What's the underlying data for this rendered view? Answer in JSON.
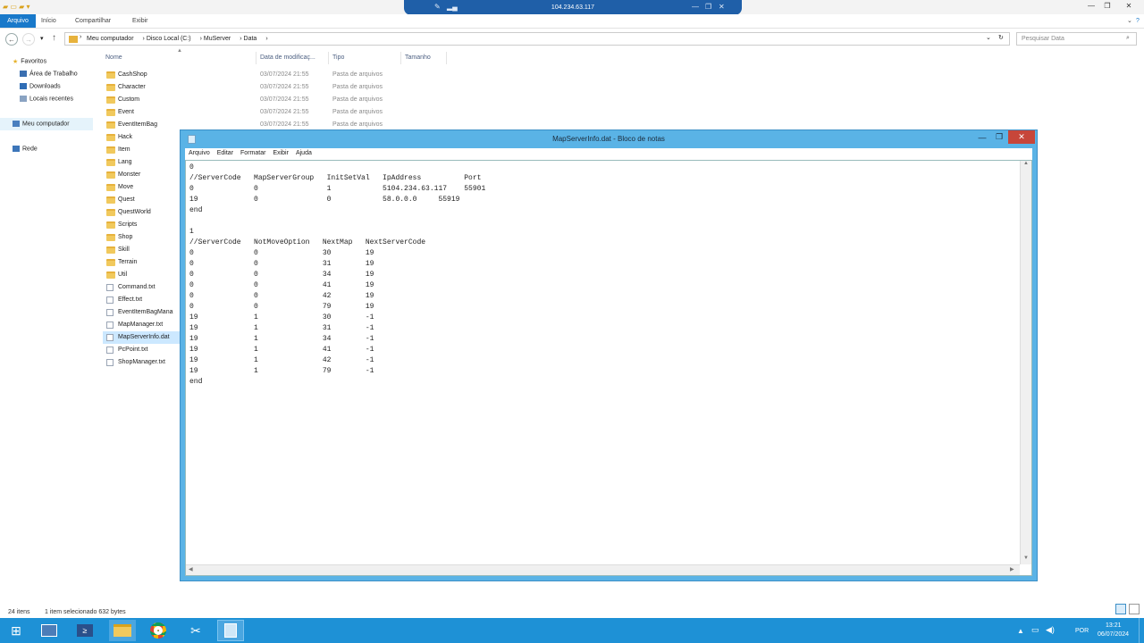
{
  "rdp": {
    "host": "104.234.63.117"
  },
  "ribbon": {
    "file": "Arquivo",
    "home": "Início",
    "share": "Compartilhar",
    "view": "Exibir"
  },
  "address": {
    "crumbs": [
      "Meu computador",
      "Disco Local (C:)",
      "MuServer",
      "Data"
    ],
    "search_placeholder": "Pesquisar Data"
  },
  "columns": {
    "name": "Nome",
    "date": "Data de modificaç...",
    "type": "Tipo",
    "size": "Tamanho"
  },
  "nav": {
    "favorites": "Favoritos",
    "desktop": "Área de Trabalho",
    "downloads": "Downloads",
    "recent": "Locais recentes",
    "computer": "Meu computador",
    "network": "Rede"
  },
  "files": [
    {
      "name": "CashShop",
      "date": "03/07/2024 21:55",
      "type": "Pasta de arquivos",
      "kind": "folder"
    },
    {
      "name": "Character",
      "date": "03/07/2024 21:55",
      "type": "Pasta de arquivos",
      "kind": "folder"
    },
    {
      "name": "Custom",
      "date": "03/07/2024 21:55",
      "type": "Pasta de arquivos",
      "kind": "folder"
    },
    {
      "name": "Event",
      "date": "03/07/2024 21:55",
      "type": "Pasta de arquivos",
      "kind": "folder"
    },
    {
      "name": "EventItemBag",
      "date": "03/07/2024 21:55",
      "type": "Pasta de arquivos",
      "kind": "folder"
    },
    {
      "name": "Hack",
      "date": "",
      "type": "",
      "kind": "folder"
    },
    {
      "name": "Item",
      "date": "",
      "type": "",
      "kind": "folder"
    },
    {
      "name": "Lang",
      "date": "",
      "type": "",
      "kind": "folder"
    },
    {
      "name": "Monster",
      "date": "",
      "type": "",
      "kind": "folder"
    },
    {
      "name": "Move",
      "date": "",
      "type": "",
      "kind": "folder"
    },
    {
      "name": "Quest",
      "date": "",
      "type": "",
      "kind": "folder"
    },
    {
      "name": "QuestWorld",
      "date": "",
      "type": "",
      "kind": "folder"
    },
    {
      "name": "Scripts",
      "date": "",
      "type": "",
      "kind": "folder"
    },
    {
      "name": "Shop",
      "date": "",
      "type": "",
      "kind": "folder"
    },
    {
      "name": "Skill",
      "date": "",
      "type": "",
      "kind": "folder"
    },
    {
      "name": "Terrain",
      "date": "",
      "type": "",
      "kind": "folder"
    },
    {
      "name": "Util",
      "date": "",
      "type": "",
      "kind": "folder"
    },
    {
      "name": "Command.txt",
      "date": "",
      "type": "",
      "kind": "file"
    },
    {
      "name": "Effect.txt",
      "date": "",
      "type": "",
      "kind": "file"
    },
    {
      "name": "EventItemBagMana",
      "date": "",
      "type": "",
      "kind": "file"
    },
    {
      "name": "MapManager.txt",
      "date": "",
      "type": "",
      "kind": "file"
    },
    {
      "name": "MapServerInfo.dat",
      "date": "",
      "type": "",
      "kind": "file",
      "selected": true
    },
    {
      "name": "PcPoint.txt",
      "date": "",
      "type": "",
      "kind": "file"
    },
    {
      "name": "ShopManager.txt",
      "date": "",
      "type": "",
      "kind": "file"
    }
  ],
  "status": {
    "count": "24 itens",
    "selected": "1 item selecionado  632 bytes"
  },
  "notepad": {
    "title": "MapServerInfo.dat - Bloco de notas",
    "menu": [
      "Arquivo",
      "Editar",
      "Formatar",
      "Exibir",
      "Ajuda"
    ],
    "content": "0\n//ServerCode   MapServerGroup   InitSetVal   IpAddress          Port\n0              0                1            5104.234.63.117    55901\n19             0                0            58.0.0.0     55919\nend\n\n1\n//ServerCode   NotMoveOption   NextMap   NextServerCode\n0              0               30        19\n0              0               31        19\n0              0               34        19\n0              0               41        19\n0              0               42        19\n0              0               79        19\n19             1               30        -1\n19             1               31        -1\n19             1               34        -1\n19             1               41        -1\n19             1               42        -1\n19             1               79        -1\nend"
  },
  "tray": {
    "lang": "POR",
    "time": "13:21",
    "date": "06/07/2024"
  }
}
